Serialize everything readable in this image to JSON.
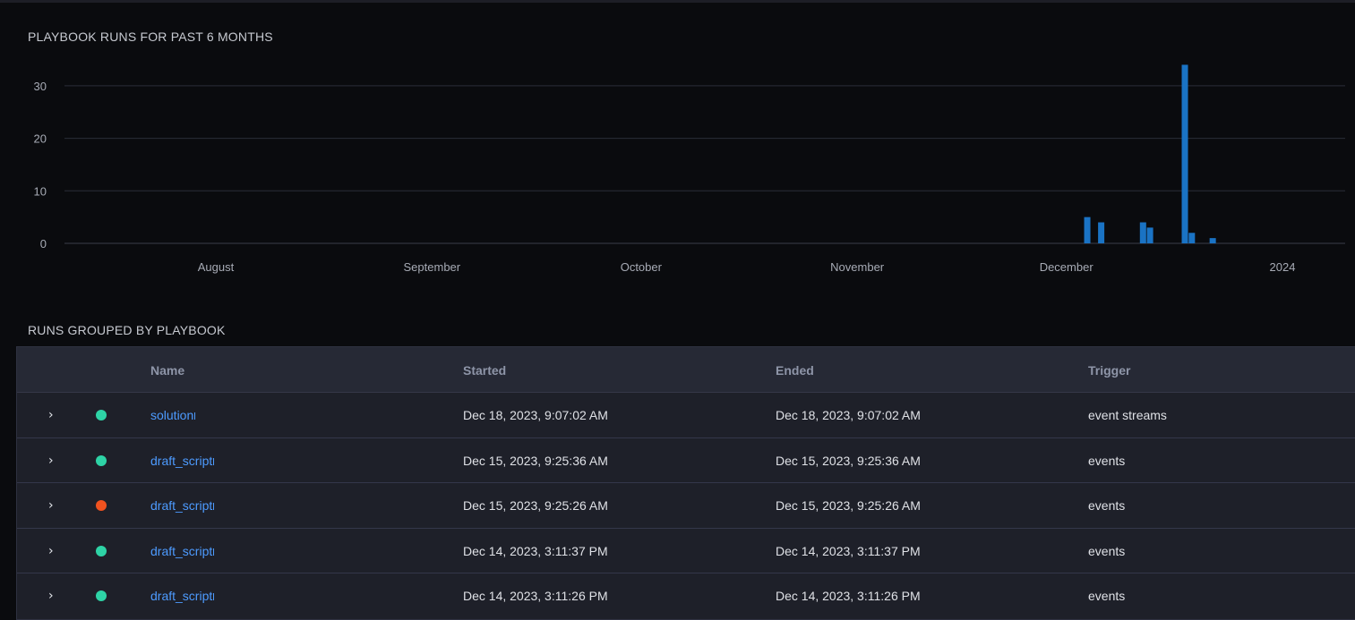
{
  "chart_title": "PLAYBOOK RUNS FOR PAST 6 MONTHS",
  "table_title": "RUNS GROUPED BY PLAYBOOK",
  "chart_data": {
    "type": "bar",
    "title": "PLAYBOOK RUNS FOR PAST 6 MONTHS",
    "xlabel": "",
    "ylabel": "",
    "ylim": [
      0,
      34
    ],
    "yticks": [
      0,
      10,
      20,
      30
    ],
    "xtick_labels": [
      "August",
      "September",
      "October",
      "November",
      "December",
      "2024"
    ],
    "x": [
      "2023-12-04",
      "2023-12-06",
      "2023-12-12",
      "2023-12-13",
      "2023-12-18",
      "2023-12-19",
      "2023-12-22"
    ],
    "values": [
      5,
      4,
      4,
      3,
      34,
      2,
      1
    ],
    "grid": true,
    "color": "#1a73c4"
  },
  "table": {
    "columns": [
      "Name",
      "Started",
      "Ended",
      "Trigger"
    ],
    "rows": [
      {
        "status": "success",
        "name": "solution",
        "started": "Dec 18, 2023, 9:07:02 AM",
        "ended": "Dec 18, 2023, 9:07:02 AM",
        "trigger": "event streams"
      },
      {
        "status": "success",
        "name": "draft_script",
        "started": "Dec 15, 2023, 9:25:36 AM",
        "ended": "Dec 15, 2023, 9:25:36 AM",
        "trigger": "events"
      },
      {
        "status": "failed",
        "name": "draft_script",
        "started": "Dec 15, 2023, 9:25:26 AM",
        "ended": "Dec 15, 2023, 9:25:26 AM",
        "trigger": "events"
      },
      {
        "status": "success",
        "name": "draft_script",
        "started": "Dec 14, 2023, 3:11:37 PM",
        "ended": "Dec 14, 2023, 3:11:37 PM",
        "trigger": "events"
      },
      {
        "status": "success",
        "name": "draft_script",
        "started": "Dec 14, 2023, 3:11:26 PM",
        "ended": "Dec 14, 2023, 3:11:26 PM",
        "trigger": "events"
      }
    ]
  },
  "status_colors": {
    "success": "#2ed3a6",
    "failed": "#f0521f"
  },
  "icons": {
    "expand": "chevron-right-icon",
    "status": "status-dot-icon"
  }
}
